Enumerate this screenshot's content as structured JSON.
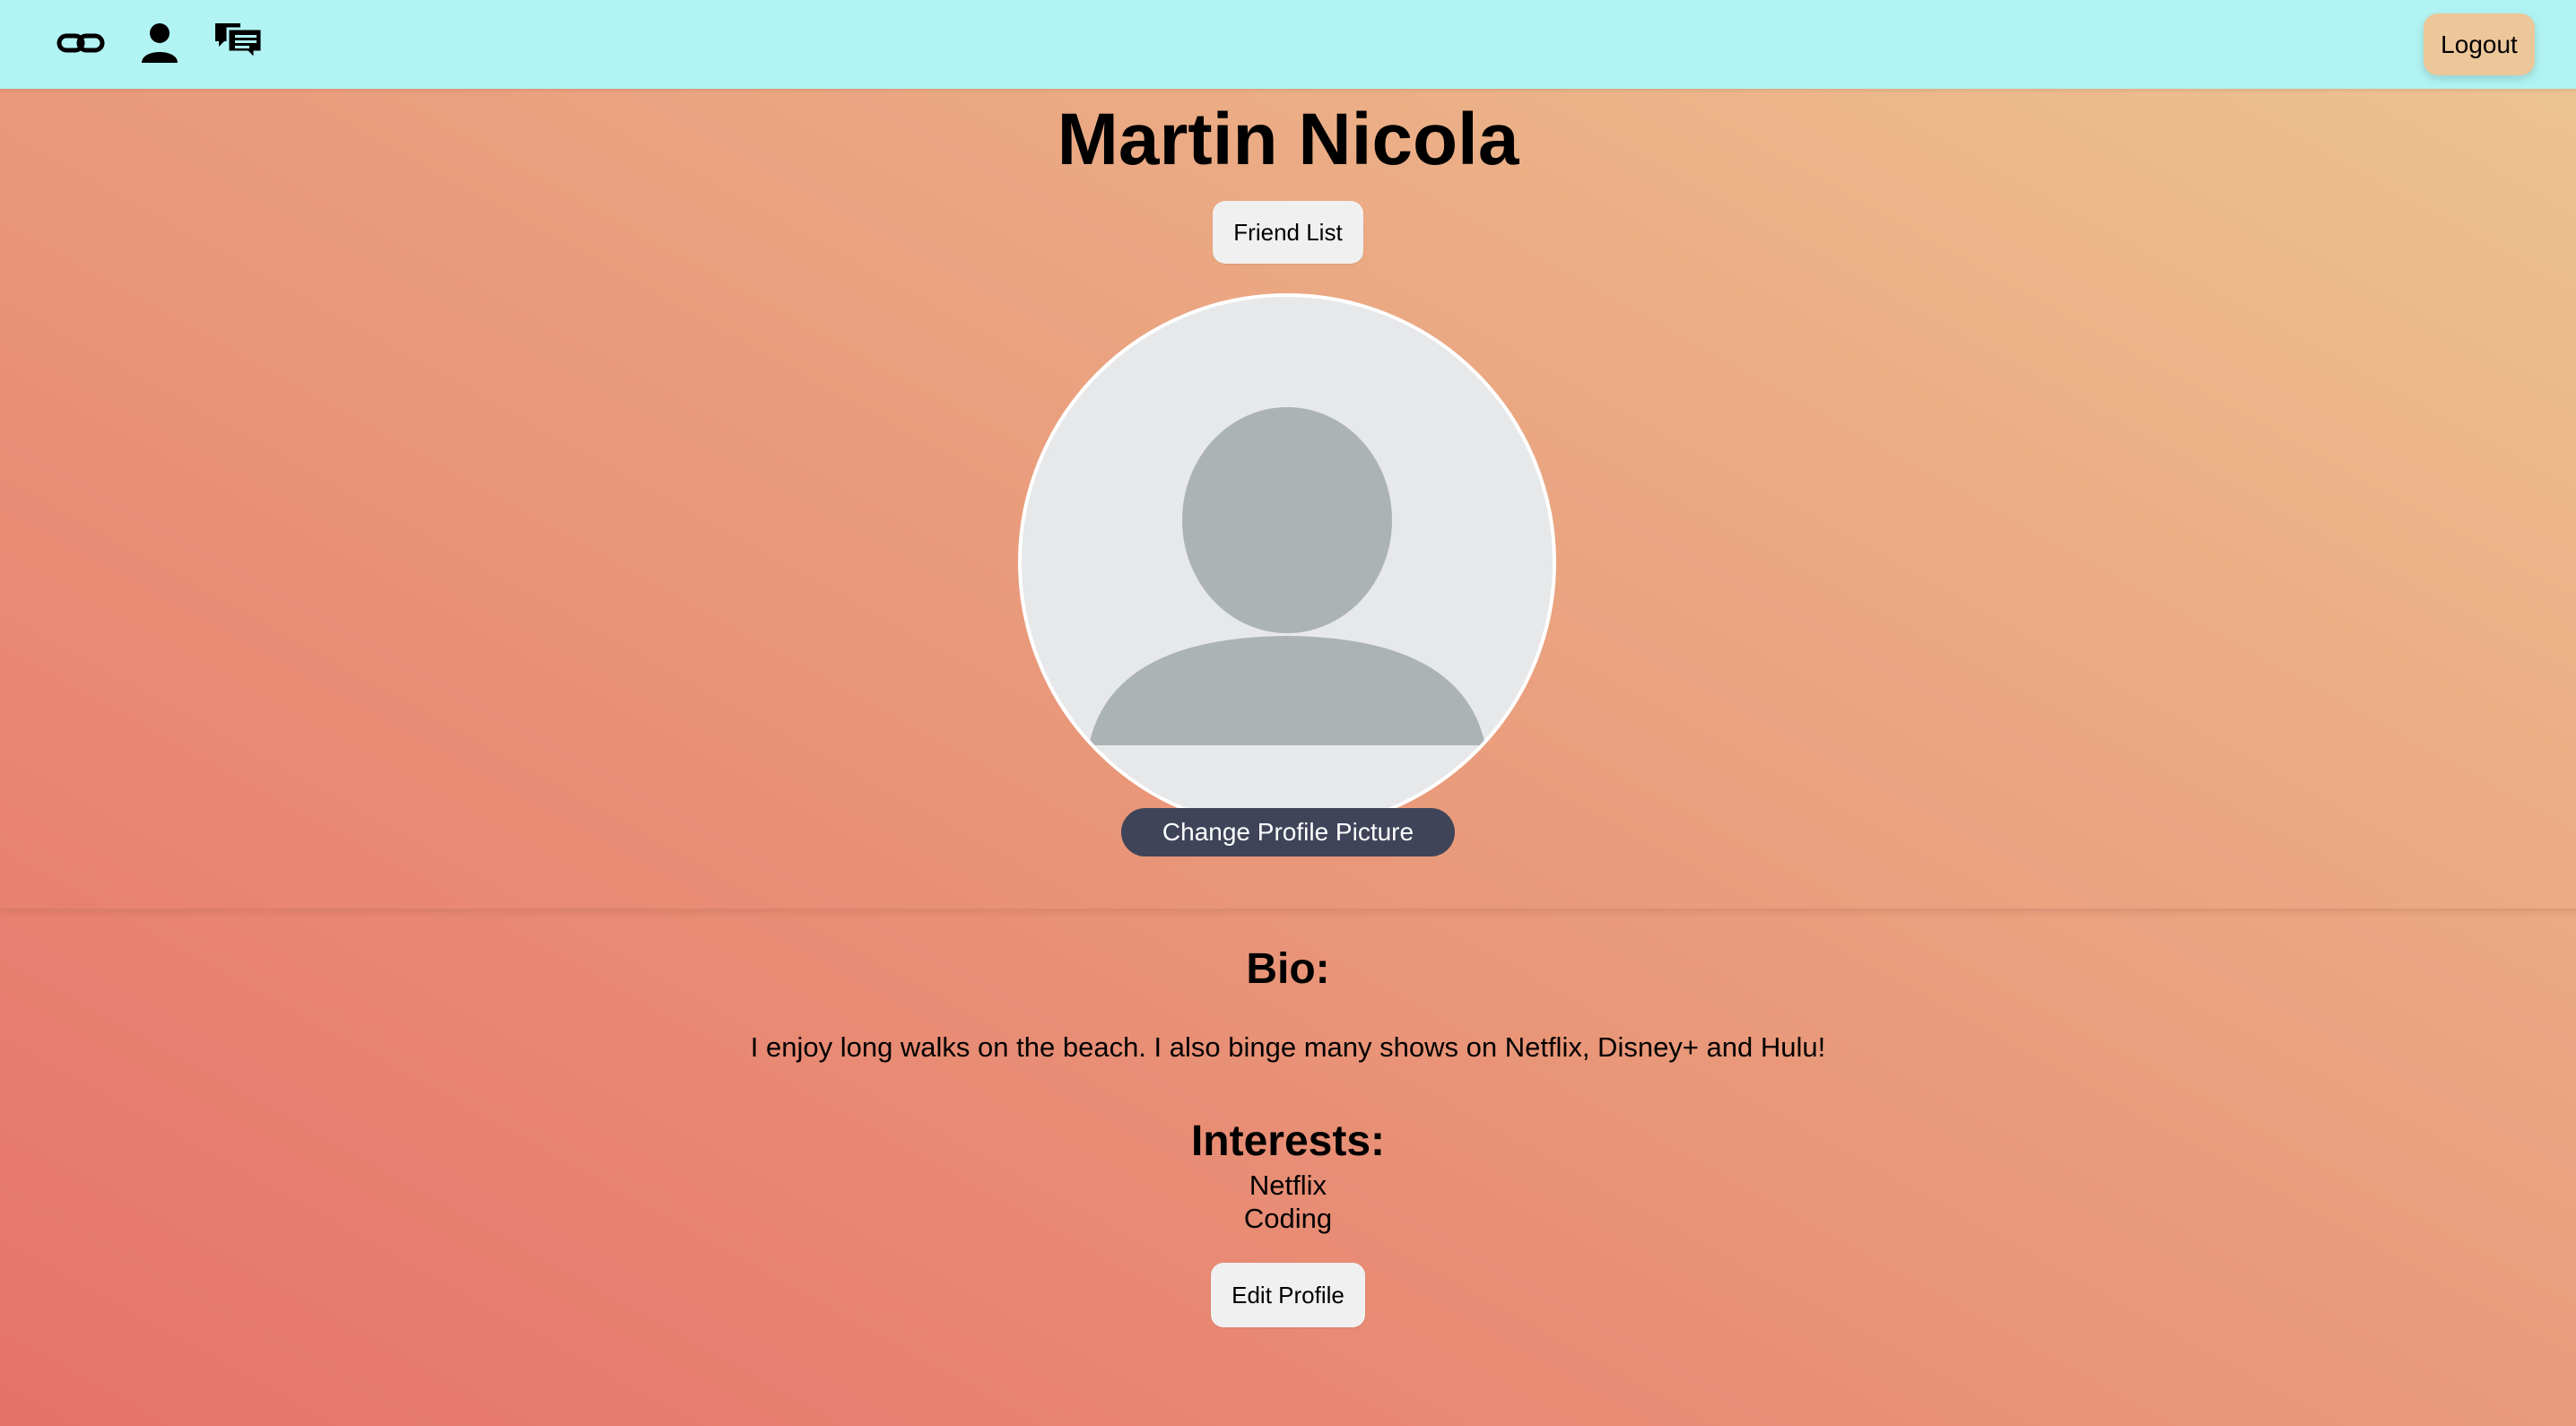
{
  "navbar": {
    "icons": [
      {
        "name": "link-icon"
      },
      {
        "name": "user-icon"
      },
      {
        "name": "chat-icon"
      }
    ],
    "logout_label": "Logout"
  },
  "profile": {
    "name": "Martin Nicola",
    "friend_list_label": "Friend List",
    "change_picture_label": "Change Profile Picture"
  },
  "bio": {
    "title": "Bio:",
    "text": "I enjoy long walks on the beach. I also binge many shows on Netflix, Disney+ and Hulu!"
  },
  "interests": {
    "title": "Interests:",
    "items": [
      "Netflix",
      "Coding"
    ]
  },
  "edit_profile_label": "Edit Profile",
  "colors": {
    "navbar": "#b1f4f3",
    "logout_button": "#ecc799",
    "change_picture_button": "#3f4459",
    "gradient_start": "#e6726a",
    "gradient_end": "#edc593"
  }
}
